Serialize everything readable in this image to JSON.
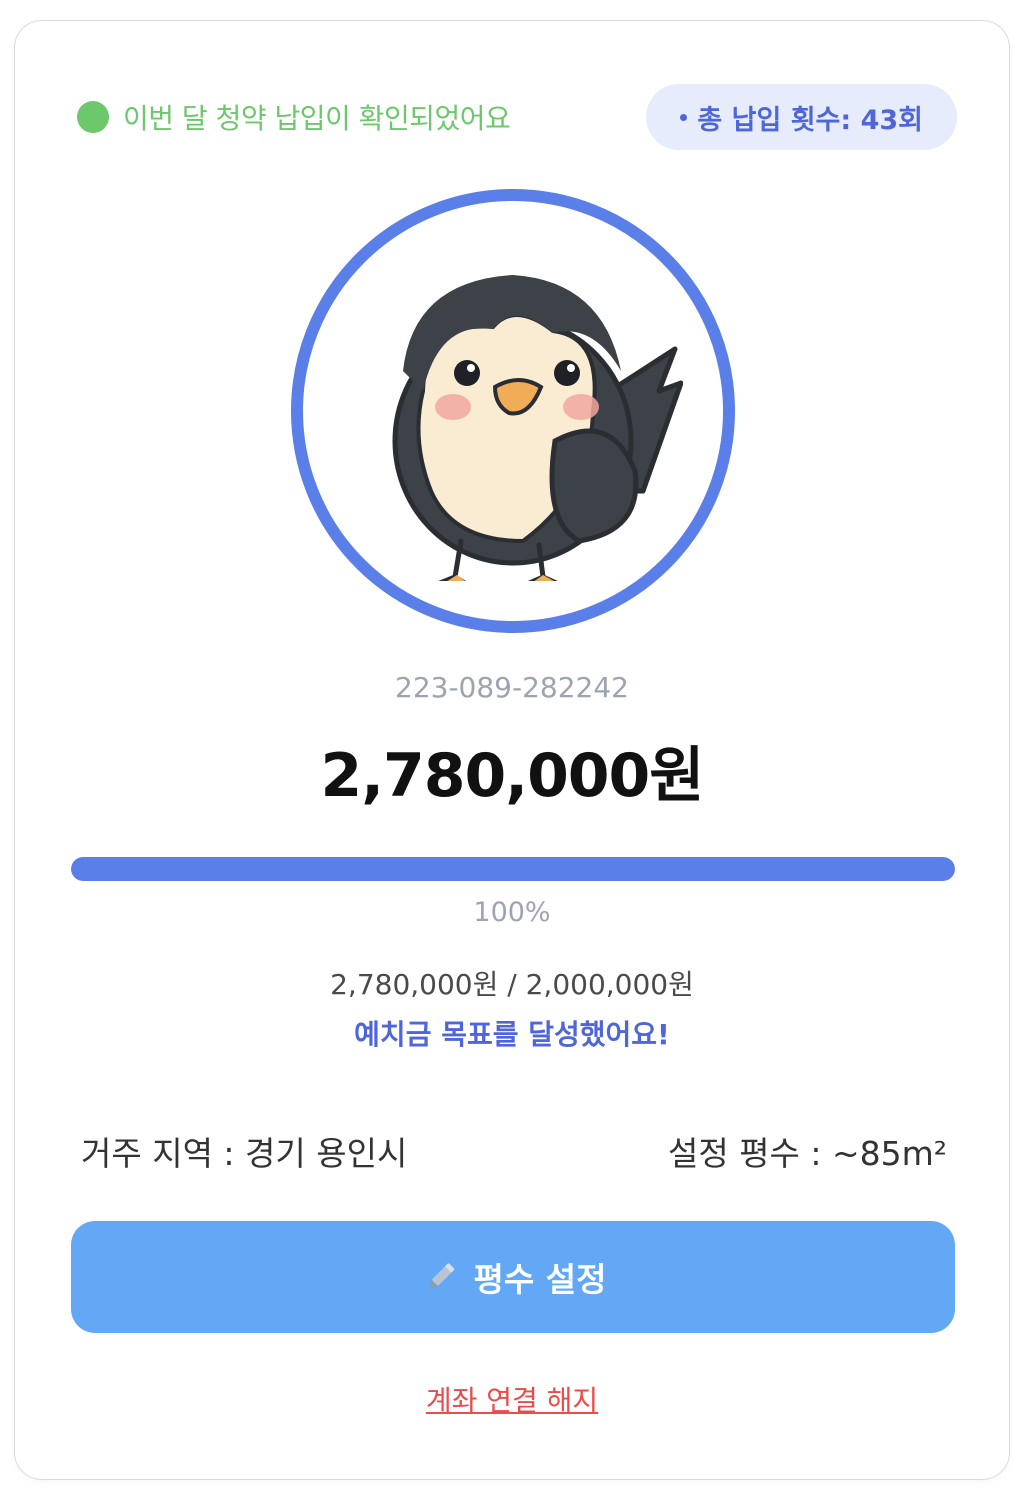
{
  "status": {
    "message": "이번 달 청약 납입이 확인되었어요",
    "dot_color": "#6cc86a",
    "icon": "green-status-dot"
  },
  "payment_count": {
    "label": "총 납입 횟수: 43회"
  },
  "avatar": {
    "icon": "penguin-bird-mascot",
    "ring_color": "#5b7fe8"
  },
  "account": {
    "number": "223-089-282242",
    "balance": "2,780,000원"
  },
  "progress": {
    "fraction": 1.0,
    "percent_label": "100%",
    "color": "#5b7fe8"
  },
  "deposit": {
    "summary": "2,780,000원 / 2,000,000원",
    "goal_message": "예치금 목표를 달성했어요!"
  },
  "info": {
    "region": "거주 지역 : 경기 용인시",
    "area": "설정 평수 : ~85m²"
  },
  "actions": {
    "settings_button_label": "평수 설정",
    "settings_button_icon": "pencil-icon",
    "settings_button_color": "#63a8f5",
    "unlink_label": "계좌 연결 해지",
    "unlink_color": "#ec4b4b"
  }
}
